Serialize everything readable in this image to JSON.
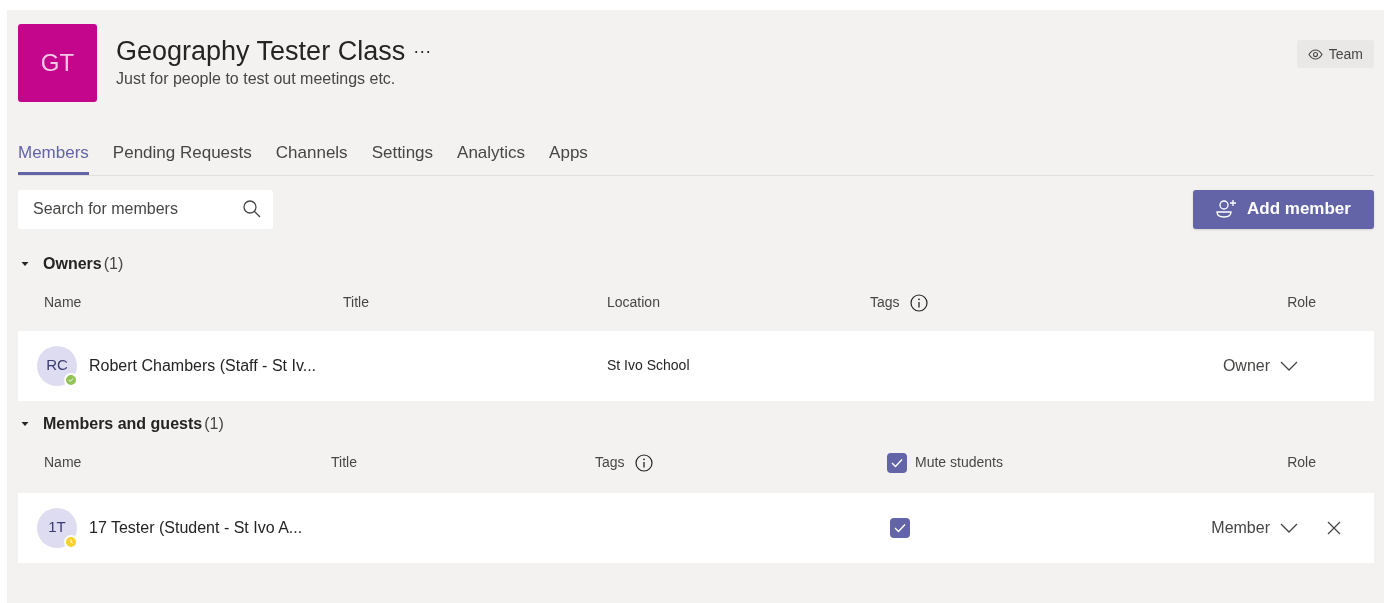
{
  "team": {
    "initials": "GT",
    "name": "Geography Tester Class",
    "more": "···",
    "description": "Just for people to test out meetings etc.",
    "view_button": "Team"
  },
  "tabs": [
    {
      "label": "Members",
      "selected": true
    },
    {
      "label": "Pending Requests",
      "selected": false
    },
    {
      "label": "Channels",
      "selected": false
    },
    {
      "label": "Settings",
      "selected": false
    },
    {
      "label": "Analytics",
      "selected": false
    },
    {
      "label": "Apps",
      "selected": false
    }
  ],
  "search": {
    "placeholder": "Search for members"
  },
  "add_button": "Add member",
  "sections": [
    {
      "kind": "owners",
      "title": "Owners",
      "count": "(1)",
      "expanded": true,
      "columns": [
        {
          "kind": "text",
          "label": "Name"
        },
        {
          "kind": "text",
          "label": "Title"
        },
        {
          "kind": "text",
          "label": "Location"
        },
        {
          "kind": "info",
          "label": "Tags"
        },
        {
          "kind": "text",
          "label": "Role"
        }
      ],
      "rows": [
        {
          "initials": "RC",
          "status": {
            "kind": "available",
            "color": "#92c353"
          },
          "name": "Robert Chambers (Staff - St Iv...",
          "location": "St Ivo School",
          "role": "Owner",
          "removable": false
        }
      ]
    },
    {
      "kind": "members",
      "title": "Members and guests",
      "count": "(1)",
      "expanded": true,
      "columns": [
        {
          "kind": "text",
          "label": "Name"
        },
        {
          "kind": "text",
          "label": "Title"
        },
        {
          "kind": "info",
          "label": "Tags"
        },
        {
          "kind": "checkbox",
          "label": "Mute students",
          "checked": true
        },
        {
          "kind": "text",
          "label": "Role"
        }
      ],
      "rows": [
        {
          "initials": "1T",
          "status": {
            "kind": "away",
            "color": "#f8d22a"
          },
          "name": "17 Tester (Student - St Ivo A...",
          "muted": true,
          "role": "Member",
          "removable": true
        }
      ]
    }
  ]
}
